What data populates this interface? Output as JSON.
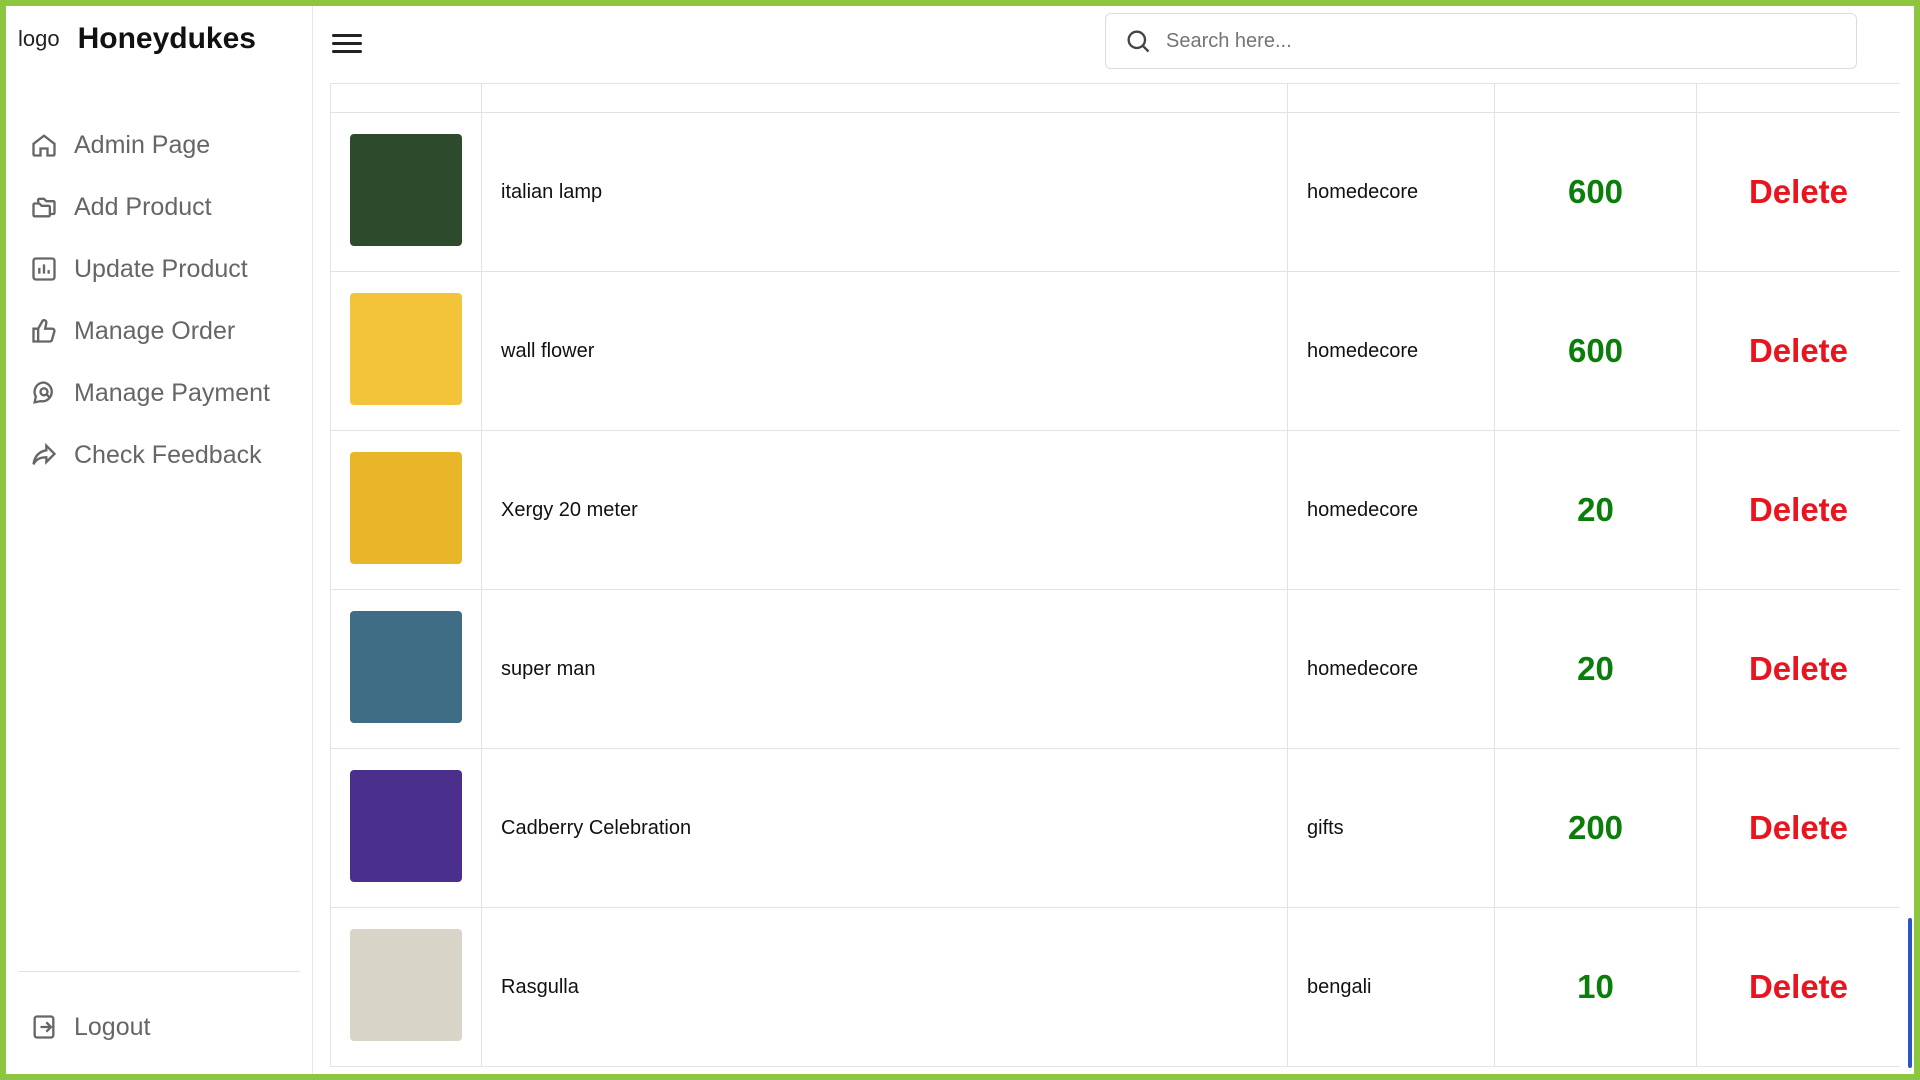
{
  "brand": {
    "logo_alt": "logo",
    "name": "Honeydukes"
  },
  "sidebar": {
    "items": [
      {
        "label": "Admin Page",
        "icon": "home-icon"
      },
      {
        "label": "Add Product",
        "icon": "folders-icon"
      },
      {
        "label": "Update Product",
        "icon": "bar-chart-icon"
      },
      {
        "label": "Manage Order",
        "icon": "thumbs-up-icon"
      },
      {
        "label": "Manage Payment",
        "icon": "chat-search-icon"
      },
      {
        "label": "Check Feedback",
        "icon": "share-arrow-icon"
      }
    ],
    "logout": {
      "label": "Logout",
      "icon": "logout-icon"
    }
  },
  "search": {
    "placeholder": "Search here..."
  },
  "products": [
    {
      "name": "italian lamp",
      "category": "homedecore",
      "price": "600",
      "action": "Delete",
      "thumb_color": "#2e4a2c"
    },
    {
      "name": "wall flower",
      "category": "homedecore",
      "price": "600",
      "action": "Delete",
      "thumb_color": "#f3c33a"
    },
    {
      "name": "Xergy 20 meter",
      "category": "homedecore",
      "price": "20",
      "action": "Delete",
      "thumb_color": "#e9b62a"
    },
    {
      "name": "super man",
      "category": "homedecore",
      "price": "20",
      "action": "Delete",
      "thumb_color": "#3f6d86"
    },
    {
      "name": "Cadberry Celebration",
      "category": "gifts",
      "price": "200",
      "action": "Delete",
      "thumb_color": "#4a2f8c"
    },
    {
      "name": "Rasgulla",
      "category": "bengali",
      "price": "10",
      "action": "Delete",
      "thumb_color": "#d9d4c8"
    }
  ],
  "colors": {
    "accent_border": "#8cc63f",
    "price": "#0a7d0a",
    "delete": "#e8141e"
  }
}
